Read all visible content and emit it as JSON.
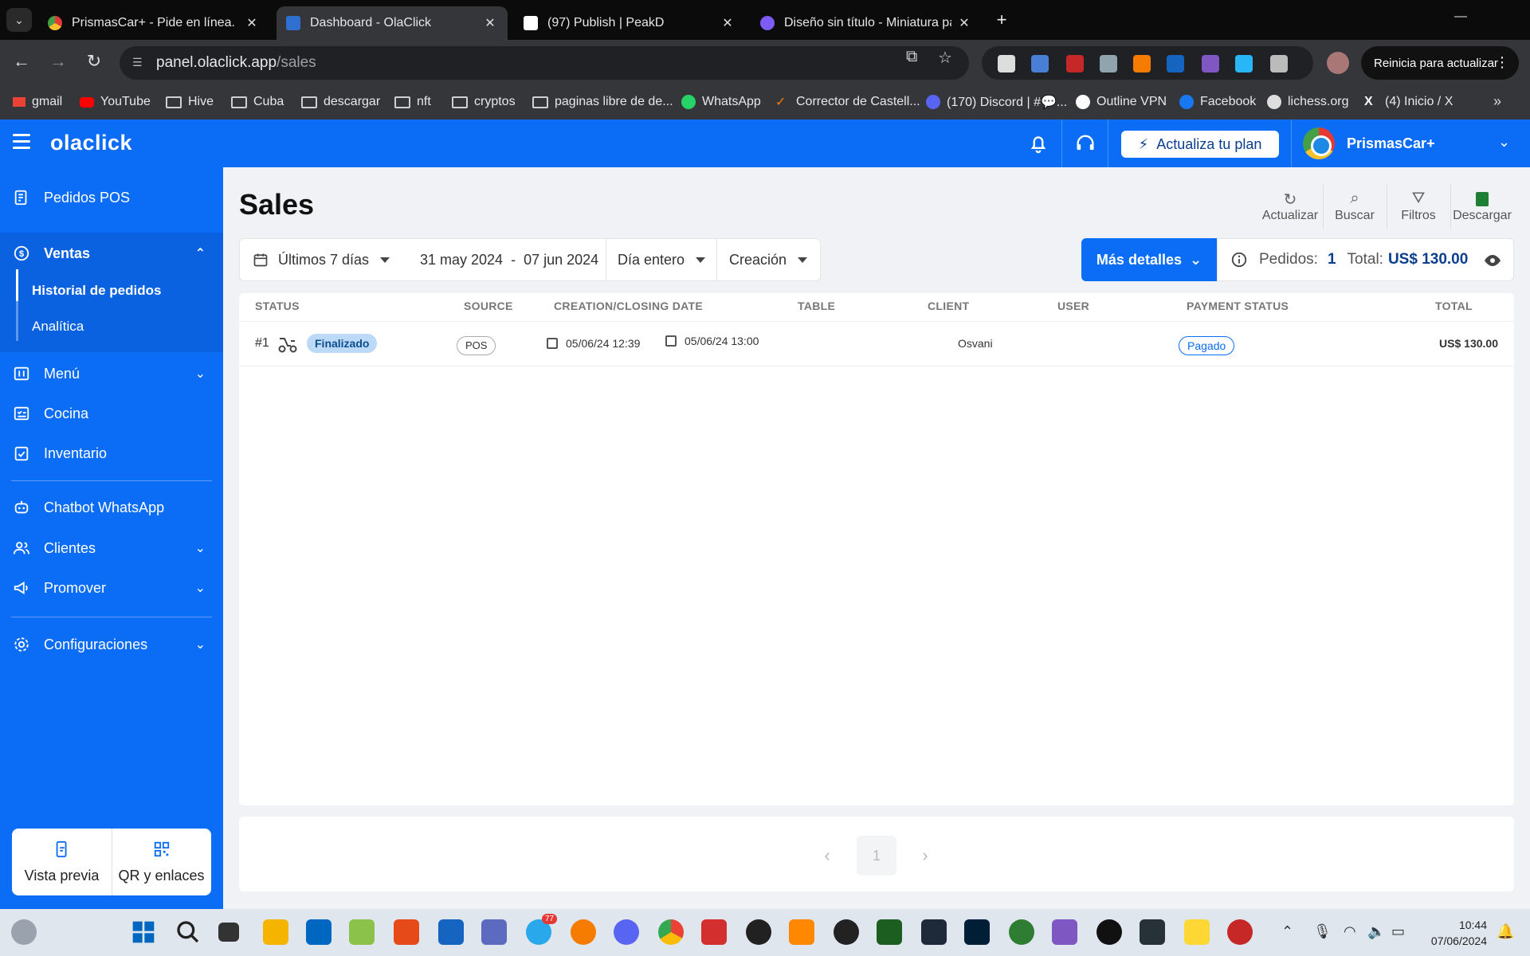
{
  "browser": {
    "tabs": [
      {
        "title": "PrismasCar+ - Pide en línea. Me",
        "active": false
      },
      {
        "title": "Dashboard - OlaClick",
        "active": true
      },
      {
        "title": "(97) Publish | PeakD",
        "active": false
      },
      {
        "title": "Diseño sin título - Miniatura pa",
        "active": false
      }
    ],
    "url_host": "panel.olaclick.app",
    "url_path": "/sales",
    "update_label": "Reinicia para actualizar",
    "bookmarks": [
      "gmail",
      "YouTube",
      "Hive",
      "Cuba",
      "descargar",
      "nft",
      "cryptos",
      "paginas libre de de...",
      "WhatsApp",
      "Corrector de Castell...",
      "(170) Discord | #💬...",
      "Outline VPN",
      "Facebook",
      "lichess.org",
      "(4) Inicio / X"
    ]
  },
  "header": {
    "logo": "olaclick",
    "plan_button": "Actualiza tu plan",
    "store_name": "PrismasCar+"
  },
  "sidebar": {
    "items": {
      "pedidos_pos": "Pedidos POS",
      "ventas": "Ventas",
      "historial": "Historial de pedidos",
      "analitica": "Analítica",
      "menu": "Menú",
      "cocina": "Cocina",
      "inventario": "Inventario",
      "chatbot": "Chatbot WhatsApp",
      "clientes": "Clientes",
      "promover": "Promover",
      "configuraciones": "Configuraciones"
    },
    "bottom": {
      "preview": "Vista previa",
      "qr": "QR y enlaces"
    }
  },
  "main": {
    "title": "Sales",
    "tools": {
      "refresh": "Actualizar",
      "search": "Buscar",
      "filters": "Filtros",
      "download": "Descargar"
    },
    "filters": {
      "range": "Últimos 7 días",
      "date_from": "31 may 2024",
      "date_sep": "-",
      "date_to": "07 jun 2024",
      "time": "Día entero",
      "type": "Creación"
    },
    "details_button": "Más detalles",
    "summary": {
      "orders_label": "Pedidos:",
      "orders_value": "1",
      "total_label": "Total:",
      "total_value": "US$ 130.00"
    },
    "table": {
      "headers": [
        "STATUS",
        "SOURCE",
        "CREATION/CLOSING DATE",
        "TABLE",
        "CLIENT",
        "USER",
        "PAYMENT STATUS",
        "TOTAL"
      ],
      "rows": [
        {
          "id": "#1",
          "status": "Finalizado",
          "source": "POS",
          "created": "05/06/24 12:39",
          "closed": "05/06/24 13:00",
          "table": "",
          "client": "Osvani",
          "user": "",
          "payment": "Pagado",
          "total": "US$ 130.00"
        }
      ]
    },
    "pagination": {
      "current": "1"
    }
  },
  "taskbar": {
    "time": "10:44",
    "date": "07/06/2024",
    "telegram_badge": "77"
  },
  "colors": {
    "brand": "#0b6cf5",
    "dark_blue": "#0b3e8f"
  }
}
